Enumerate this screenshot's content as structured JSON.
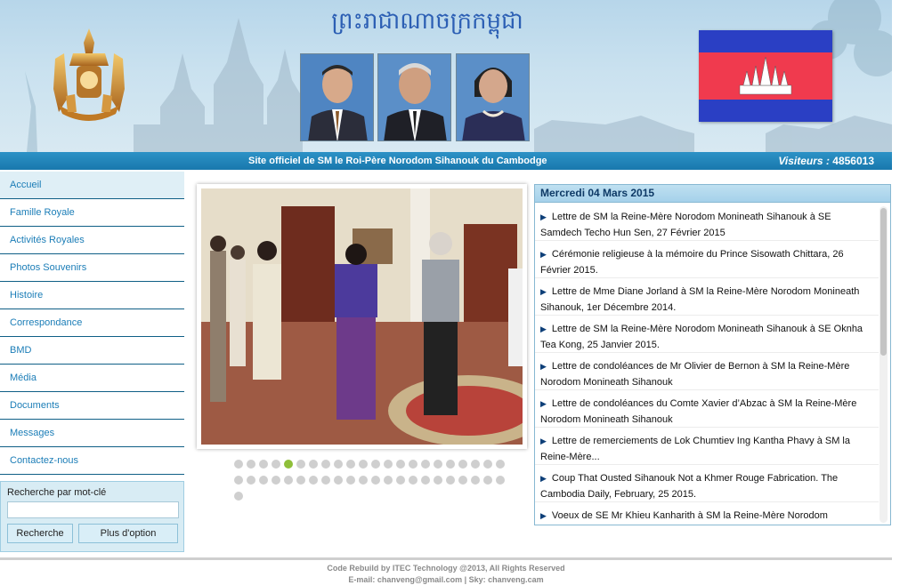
{
  "header": {
    "khmer_title": "ព្រះរាជាណាចក្រកម្ពុជា",
    "site_title": "Site officiel de SM le Roi-Père Norodom Sihanouk du Cambodge",
    "visitors_label": "Visiteurs :",
    "visitors_count": "4856013",
    "colors": {
      "bar": "#1f82b8",
      "flag_blue": "#2a3fc4",
      "flag_red": "#f03a4e"
    }
  },
  "nav": {
    "items": [
      "Accueil",
      "Famille Royale",
      "Activités Royales",
      "Photos Souvenirs",
      "Histoire",
      "Correspondance",
      "BMD",
      "Média",
      "Documents",
      "Messages",
      "Contactez-nous"
    ],
    "active": "Accueil"
  },
  "search": {
    "label": "Recherche par mot-clé",
    "value": "",
    "search_button": "Recherche",
    "more_button": "Plus d'option"
  },
  "slideshow": {
    "total_dots": 45,
    "active_dot": 5
  },
  "news": {
    "date": "Mercredi 04 Mars 2015",
    "items": [
      "Lettre de SM la Reine-Mère Norodom Monineath Sihanouk à SE Samdech Techo Hun Sen, 27 Février 2015",
      "Cérémonie religieuse à la mémoire du Prince Sisowath Chittara, 26 Février 2015.",
      "Lettre de Mme Diane Jorland à SM la Reine-Mère Norodom Monineath Sihanouk, 1er Décembre 2014.",
      "Lettre de SM la Reine-Mère Norodom Monineath Sihanouk à SE Oknha Tea Kong, 25 Janvier 2015.",
      "Lettre de condoléances de Mr Olivier de Bernon à SM la Reine-Mère Norodom Monineath Sihanouk",
      "Lettre de condoléances du Comte Xavier d’Abzac à SM la Reine-Mère Norodom Monineath Sihanouk",
      "Lettre de remerciements de Lok Chumtiev Ing Kantha Phavy à SM la Reine-Mère...",
      "Coup That Ousted Sihanouk Not a Khmer Rouge Fabrication. The Cambodia Daily, February, 25 2015.",
      "Voeux de SE Mr Khieu Kanharith à SM la Reine-Mère Norodom"
    ]
  },
  "footer": {
    "line1": "Code Rebuild by ITEC Technology @2013, All Rights Reserved",
    "line2": "E-mail: chanveng@gmail.com | Sky: chanveng.cam"
  }
}
